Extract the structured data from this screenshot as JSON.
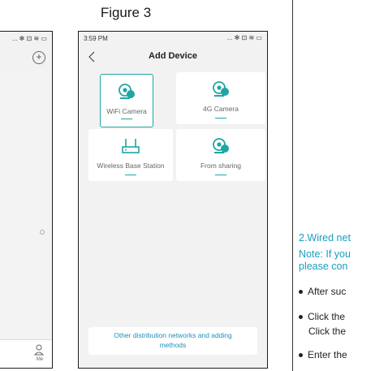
{
  "figure": {
    "title": "Figure 3"
  },
  "left_phone": {
    "status_icons": "... ✻ ⊡ ≋ ▭",
    "add_icon": "+",
    "tab_me_label": "Me"
  },
  "main_phone": {
    "status_time": "3:59 PM",
    "status_icons": "... ✻ ⊡ ≋ ▭",
    "title": "Add Device",
    "devices": [
      {
        "label": "WiFi Camera",
        "icon": "wifi-camera-icon",
        "selected": true
      },
      {
        "label": "4G Camera",
        "icon": "4g-camera-icon",
        "selected": false
      },
      {
        "label": "Wireless Base Station",
        "icon": "base-station-icon",
        "selected": false
      },
      {
        "label": "From sharing",
        "icon": "share-camera-icon",
        "selected": false
      }
    ],
    "other_methods_line1": "Other distribution networks and adding",
    "other_methods_line2": "methods"
  },
  "right_text": {
    "heading": "2.Wired net",
    "note_line1": "Note: If you",
    "note_line2": "please con",
    "bullet1": "After suc",
    "bullet2_line1": "Click the",
    "bullet2_line2": "Click the",
    "bullet3": "Enter the"
  },
  "colors": {
    "accent": "#1fa6a3",
    "link": "#1e8fbf",
    "note": "#1a9dc0"
  }
}
